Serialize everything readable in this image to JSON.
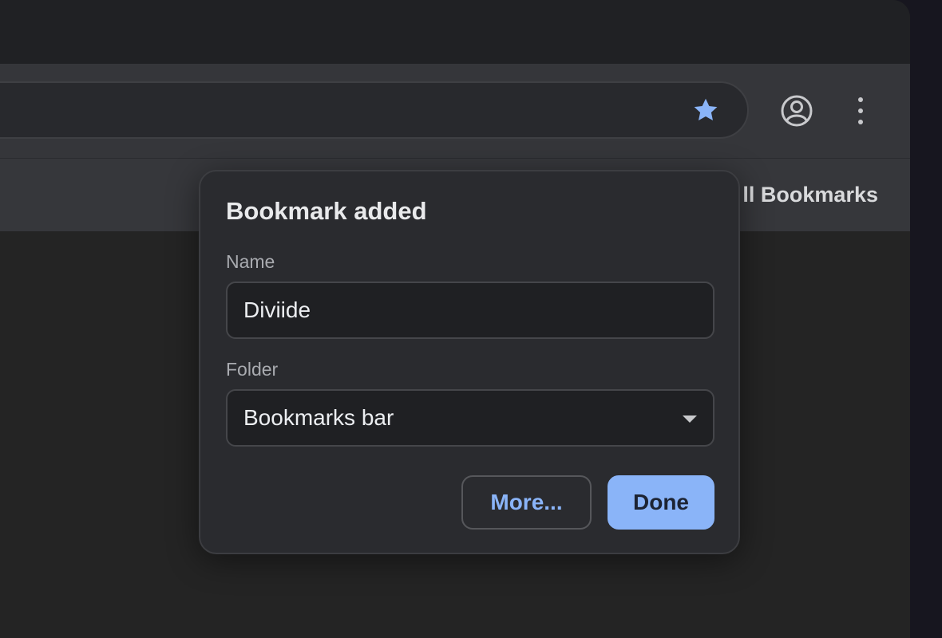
{
  "toolbar": {
    "bookmark_star_color": "#8ab4f8"
  },
  "bookmarks_bar": {
    "all_bookmarks_label": "ll Bookmarks"
  },
  "dialog": {
    "title": "Bookmark added",
    "name_label": "Name",
    "name_value": "Diviide",
    "folder_label": "Folder",
    "folder_value": "Bookmarks bar",
    "more_button": "More...",
    "done_button": "Done"
  },
  "icons": {
    "star": "star-icon",
    "profile": "profile-icon",
    "menu": "more-vertical-icon",
    "dropdown": "chevron-down-icon"
  },
  "colors": {
    "accent": "#8ab4f8",
    "dialog_bg": "#2a2b2f",
    "toolbar_bg": "#35363a"
  }
}
